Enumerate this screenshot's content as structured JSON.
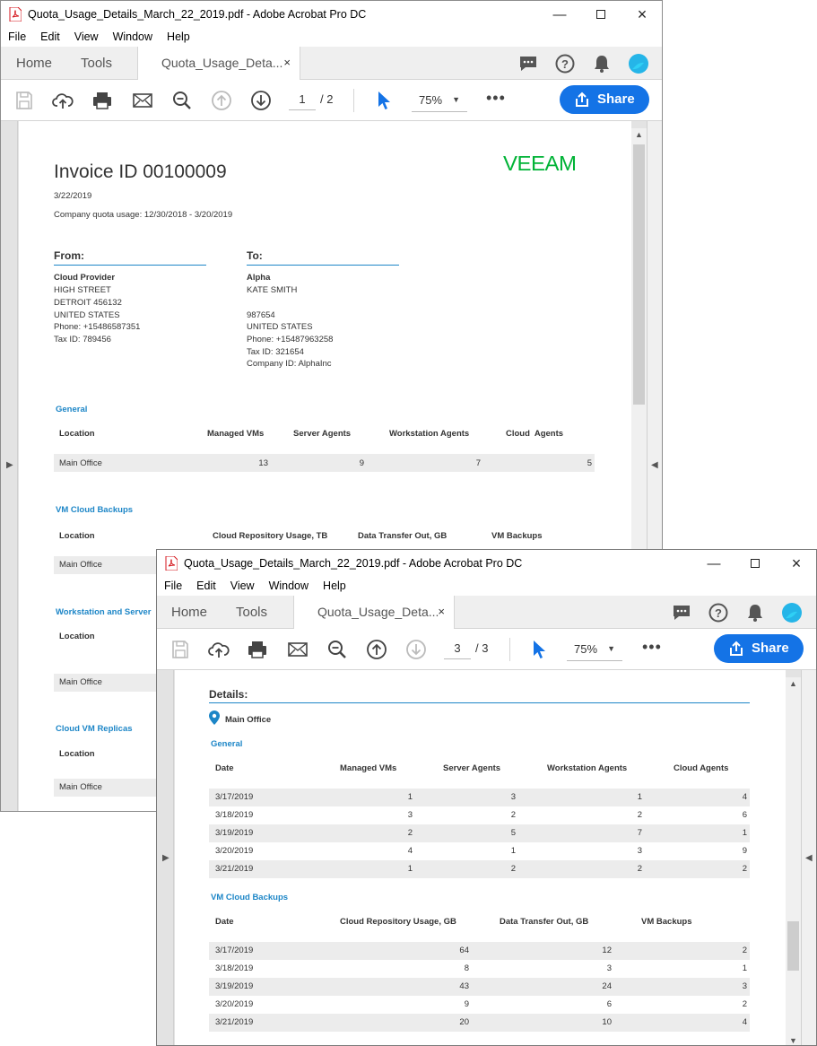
{
  "app": {
    "menu": [
      "File",
      "Edit",
      "View",
      "Window",
      "Help"
    ],
    "tabs": {
      "home": "Home",
      "tools": "Tools"
    },
    "share_label": "Share",
    "zoom": "75%",
    "close_glyph": "×"
  },
  "window1": {
    "title": "Quota_Usage_Details_March_22_2019.pdf - Adobe Acrobat Pro DC",
    "doc_tab": "Quota_Usage_Deta...",
    "page_current": "1",
    "page_total": "/  2",
    "invoice": {
      "title": "Invoice ID 00100009",
      "logo": "VEEAM",
      "date": "3/22/2019",
      "quota_usage": "Company quota usage: 12/30/2018 - 3/20/2019",
      "from_header": "From:",
      "to_header": "To:",
      "from": {
        "name": "Cloud Provider",
        "lines": [
          "HIGH STREET",
          "DETROIT 456132",
          "UNITED STATES",
          "Phone: +15486587351",
          "Tax ID: 789456"
        ]
      },
      "to": {
        "name": "Alpha",
        "lines": [
          "KATE SMITH",
          "",
          " 987654",
          "UNITED STATES",
          "Phone: +15487963258",
          "Tax ID: 321654",
          "Company ID: AlphaInc"
        ]
      },
      "general": {
        "title": "General",
        "headers": [
          "Location",
          "Managed VMs",
          "Server Agents",
          "Workstation Agents",
          "Cloud  Agents"
        ],
        "row": [
          "Main Office",
          "13",
          "9",
          "7",
          "5"
        ]
      },
      "vm_cloud_backups": {
        "title": "VM Cloud Backups",
        "headers": [
          "Location",
          "Cloud Repository Usage, TB",
          "Data Transfer Out, GB",
          "VM Backups"
        ],
        "row": [
          "Main Office"
        ]
      },
      "workstation": {
        "title": "Workstation and Server",
        "location": "Location",
        "row": "Main Office"
      },
      "replicas": {
        "title": "Cloud VM Replicas",
        "location": "Location",
        "row": "Main Office"
      }
    }
  },
  "window2": {
    "title": "Quota_Usage_Details_March_22_2019.pdf - Adobe Acrobat Pro DC",
    "doc_tab": "Quota_Usage_Deta...",
    "page_current": "3",
    "page_total": "/  3",
    "details": {
      "header": "Details:",
      "location": "Main Office",
      "general": {
        "title": "General",
        "headers": [
          "Date",
          "Managed VMs",
          "Server Agents",
          "Workstation Agents",
          "Cloud Agents"
        ],
        "rows": [
          [
            "3/17/2019",
            "1",
            "3",
            "1",
            "4"
          ],
          [
            "3/18/2019",
            "3",
            "2",
            "2",
            "6"
          ],
          [
            "3/19/2019",
            "2",
            "5",
            "7",
            "1"
          ],
          [
            "3/20/2019",
            "4",
            "1",
            "3",
            "9"
          ],
          [
            "3/21/2019",
            "1",
            "2",
            "2",
            "2"
          ]
        ]
      },
      "vm_cloud_backups": {
        "title": "VM Cloud Backups",
        "headers": [
          "Date",
          "Cloud Repository Usage, GB",
          "Data Transfer Out, GB",
          "VM Backups"
        ],
        "rows": [
          [
            "3/17/2019",
            "64",
            "12",
            "2"
          ],
          [
            "3/18/2019",
            "8",
            "3",
            "1"
          ],
          [
            "3/19/2019",
            "43",
            "24",
            "3"
          ],
          [
            "3/20/2019",
            "9",
            "6",
            "2"
          ],
          [
            "3/21/2019",
            "20",
            "10",
            "4"
          ]
        ]
      }
    }
  },
  "colors": {
    "accent": "#1473e6",
    "section_blue": "#1d86c7",
    "veeam_green": "#00b336"
  }
}
